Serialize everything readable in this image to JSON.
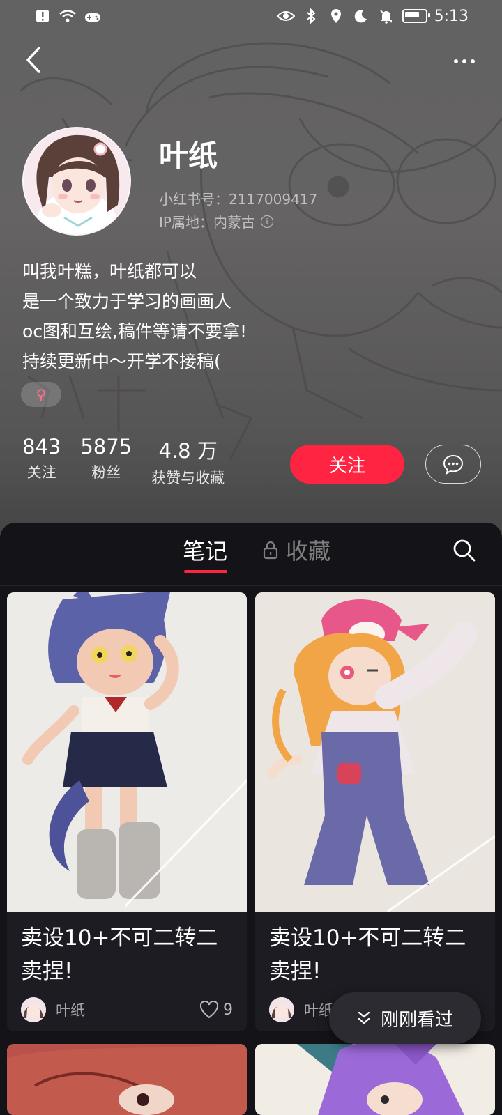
{
  "status_bar": {
    "time": "5:13"
  },
  "profile": {
    "name": "叶纸",
    "id_line": "小红书号：2117009417",
    "ip_line": "IP属地：内蒙古",
    "bio": [
      "叫我叶糕，叶纸都可以",
      "是一个致力于学习的画画人",
      "oc图和互绘,稿件等请不要拿!",
      "持续更新中～开学不接稿("
    ],
    "gender_symbol": "♀",
    "stats": [
      {
        "value": "843",
        "label": "关注"
      },
      {
        "value": "5875",
        "label": "粉丝"
      },
      {
        "value": "4.8 万",
        "label": "获赞与收藏"
      }
    ],
    "follow_label": "关注"
  },
  "tabs": {
    "notes": "笔记",
    "favorites": "收藏"
  },
  "notes": [
    {
      "title_line1": "卖设10+不可二转二",
      "title_line2": "卖捏!",
      "author": "叶纸",
      "likes": "9"
    },
    {
      "title_line1": "卖设10+不可二转二",
      "title_line2": "卖捏!",
      "author": "叶纸",
      "likes": ""
    }
  ],
  "recently_viewed": "刚刚看过",
  "colors": {
    "accent": "#ff2442",
    "panel_bg": "#141418",
    "card_bg": "#1c1c22"
  }
}
